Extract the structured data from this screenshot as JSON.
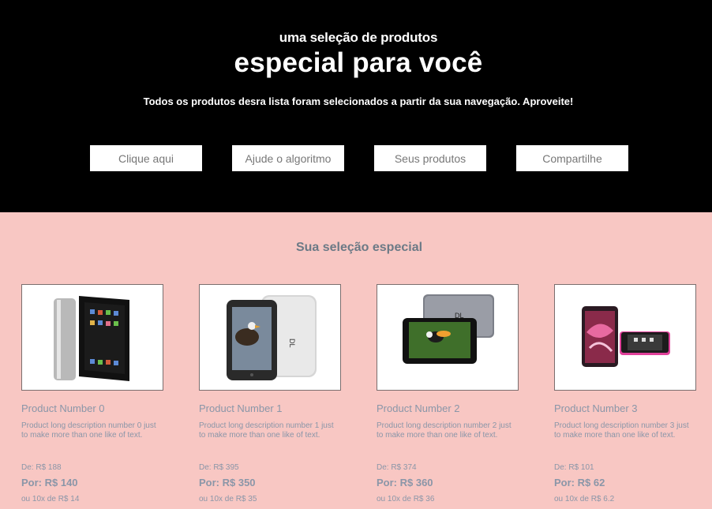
{
  "hero": {
    "subtitle": "uma seleção de produtos",
    "title": "especial para você",
    "description": "Todos os produtos desra lista foram selecionados a partir da sua navegação. Aproveite!",
    "buttons": [
      "Clique aqui",
      "Ajude o algoritmo",
      "Seus produtos",
      "Compartilhe"
    ]
  },
  "section": {
    "title": "Sua seleção especial"
  },
  "products": [
    {
      "name": "Product Number 0",
      "description": "Product long description number 0 just to make more than one like of text.",
      "from": "De: R$ 188",
      "price": "Por: R$ 140",
      "installments": "ou 10x de R$ 14"
    },
    {
      "name": "Product Number 1",
      "description": "Product long description number 1 just to make more than one like of text.",
      "from": "De: R$ 395",
      "price": "Por: R$ 350",
      "installments": "ou 10x de R$ 35"
    },
    {
      "name": "Product Number 2",
      "description": "Product long description number 2 just to make more than one like of text.",
      "from": "De: R$ 374",
      "price": "Por: R$ 360",
      "installments": "ou 10x de R$ 36"
    },
    {
      "name": "Product Number 3",
      "description": "Product long description number 3 just to make more than one like of text.",
      "from": "De: R$ 101",
      "price": "Por: R$ 62",
      "installments": "ou 10x de R$ 6.2"
    }
  ]
}
